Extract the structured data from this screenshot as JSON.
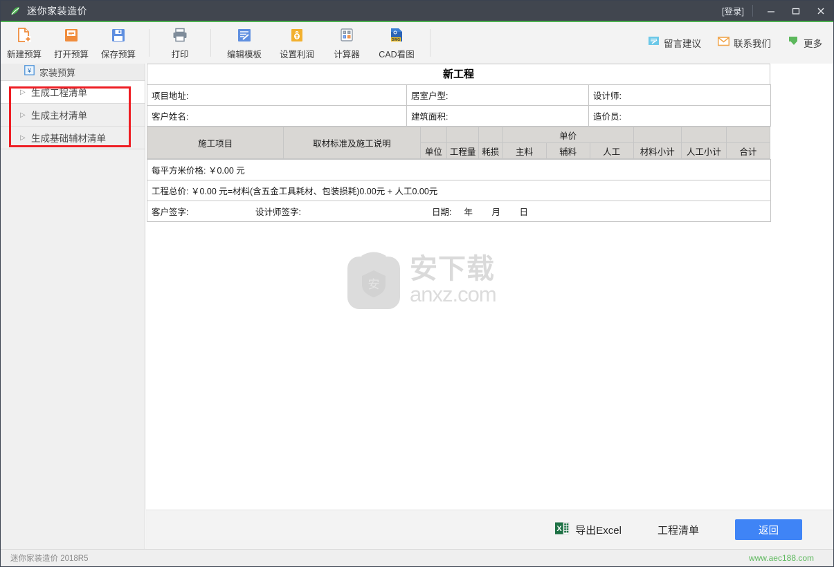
{
  "titlebar": {
    "app_title": "迷你家装造价",
    "login": "[登录]",
    "logo_icon": "leaf-logo-icon",
    "minimize_icon": "minimize-icon",
    "maximize_icon": "maximize-icon",
    "close_icon": "close-icon",
    "accent_green": "#4cb050",
    "bg": "#41464f"
  },
  "toolbar": {
    "items": [
      {
        "label": "新建预算",
        "icon": "new-document-icon"
      },
      {
        "label": "打开预算",
        "icon": "open-folder-icon"
      },
      {
        "label": "保存预算",
        "icon": "save-floppy-icon"
      },
      {
        "label": "打印",
        "icon": "printer-icon"
      },
      {
        "label": "编辑模板",
        "icon": "edit-template-icon"
      },
      {
        "label": "设置利润",
        "icon": "profit-bag-icon"
      },
      {
        "label": "计算器",
        "icon": "calculator-icon"
      },
      {
        "label": "CAD看图",
        "icon": "cad-dwg-icon"
      }
    ],
    "links": [
      {
        "label": "留言建议",
        "icon": "message-board-icon",
        "color": "#6cc8e8"
      },
      {
        "label": "联系我们",
        "icon": "envelope-icon",
        "color": "#f0a44a"
      },
      {
        "label": "更多",
        "icon": "more-down-icon",
        "color": "#5cb85c"
      }
    ]
  },
  "sidebar": {
    "header": {
      "label": "家装预算",
      "icon": "yen-budget-icon"
    },
    "items": [
      {
        "label": "生成工程清单",
        "active": true
      },
      {
        "label": "生成主材清单",
        "active": false
      },
      {
        "label": "生成基础辅材清单",
        "active": false
      }
    ],
    "highlight_color": "#ee1d23"
  },
  "document": {
    "title": "新工程",
    "meta_rows": [
      [
        "项目地址:",
        "居室户型:",
        "设计师:"
      ],
      [
        "客户姓名:",
        "建筑面积:",
        "造价员:"
      ]
    ],
    "table_header": {
      "group_label": "单价",
      "columns": [
        "施工项目",
        "取材标准及施工说明",
        "单位",
        "工程量",
        "耗损",
        "主料",
        "辅料",
        "人工",
        "材料小计",
        "人工小计",
        "合计"
      ]
    },
    "summary": {
      "per_sqm": "每平方米价格: ￥0.00 元",
      "total": "工程总价: ￥0.00 元=材料(含五金工具耗材、包装损耗)0.00元 + 人工0.00元"
    },
    "signature": {
      "customer": "客户签字:",
      "designer": "设计师签字:",
      "date": "日期:",
      "year": "年",
      "month": "月",
      "day": "日"
    }
  },
  "watermark": {
    "cn": "安下载",
    "en": "anxz.com",
    "shield_char": "安",
    "icon": "anxz-watermark-icon"
  },
  "actionbar": {
    "export_excel": "导出Excel",
    "export_icon": "excel-icon",
    "project_list": "工程清单",
    "back_button": "返回",
    "back_button_color": "#3f84f6"
  },
  "statusbar": {
    "left": "迷你家装造价 2018R5",
    "right": "www.aec188.com",
    "right_color": "#5cb85c"
  }
}
